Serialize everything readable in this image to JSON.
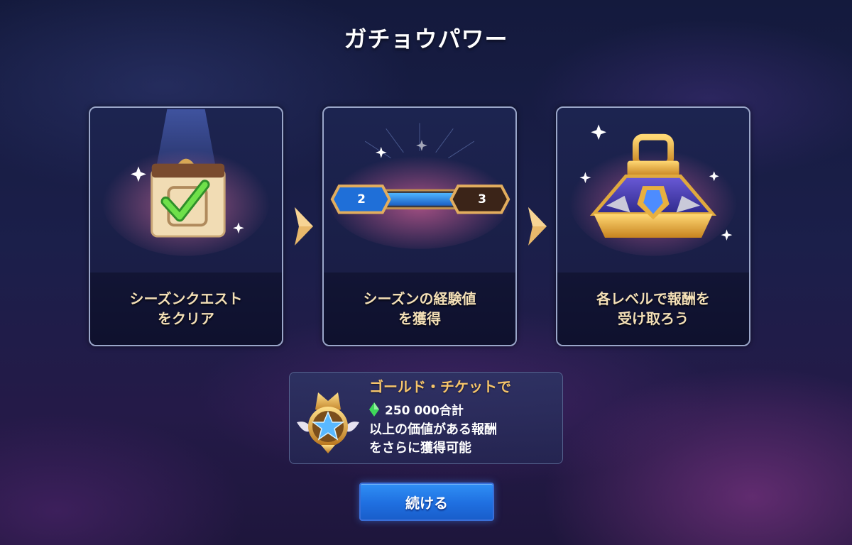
{
  "title": "ガチョウパワー",
  "steps": [
    {
      "label": "シーズンクエスト\nをクリア",
      "icon": "checklist-icon"
    },
    {
      "label": "シーズンの経験値\nを獲得",
      "icon": "level-progress-bar-icon",
      "level_from": "2",
      "level_to": "3",
      "progress": 0.8
    },
    {
      "label": "各レベルで報酬を\n受け取ろう",
      "icon": "treasure-chest-icon"
    }
  ],
  "info": {
    "line1": "ゴールド・チケットで",
    "amount": "250 000合計",
    "line3": "以上の価値がある報酬\nをさらに獲得可能",
    "badge_icon": "gold-star-badge-icon",
    "gem_icon": "green-gem-icon"
  },
  "continue_label": "続ける",
  "colors": {
    "accent_gold": "#f6c56b",
    "label_cream": "#f3dfb6",
    "button_blue": "#1f6fe0",
    "gem_green": "#3fd85a"
  }
}
